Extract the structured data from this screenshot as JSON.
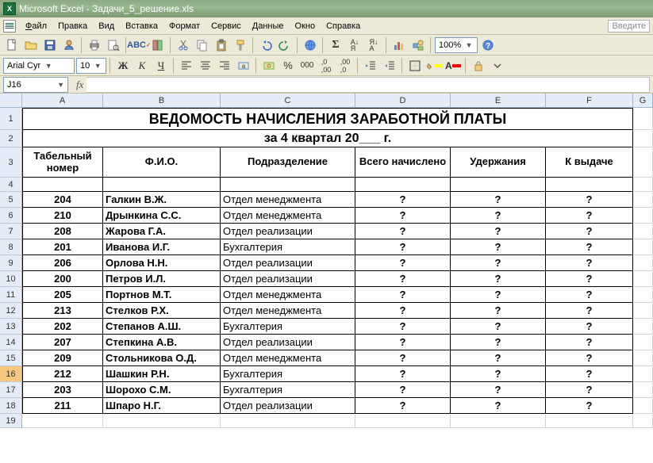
{
  "titlebar": {
    "app": "Microsoft Excel",
    "doc": "Задачи_5_решение.xls"
  },
  "menu": {
    "file": "Файл",
    "edit": "Правка",
    "view": "Вид",
    "insert": "Вставка",
    "format": "Формат",
    "tools": "Сервис",
    "data": "Данные",
    "window": "Окно",
    "help": "Справка",
    "search_hint": "Введите"
  },
  "toolbar": {
    "zoom": "100%"
  },
  "format_bar": {
    "font": "Arial Cyr",
    "size": "10",
    "bold": "Ж",
    "italic": "К",
    "underline": "Ч"
  },
  "namebox": {
    "ref": "J16",
    "fx": "fx"
  },
  "col_labels": [
    "A",
    "B",
    "C",
    "D",
    "E",
    "F",
    "G"
  ],
  "sheet": {
    "title": "ВЕДОМОСТЬ НАЧИСЛЕНИЯ ЗАРАБОТНОЙ ПЛАТЫ",
    "subtitle": "за 4 квартал 20___ г.",
    "headers": {
      "tabno": "Табельный номер",
      "fio": "Ф.И.О.",
      "dept": "Подразделение",
      "total": "Всего начислено",
      "withheld": "Удержания",
      "payout": "К выдаче"
    },
    "qmark": "?",
    "rows": [
      {
        "n": "204",
        "name": "Галкин В.Ж.",
        "dept": "Отдел менеджмента"
      },
      {
        "n": "210",
        "name": "Дрынкина С.С.",
        "dept": "Отдел менеджмента"
      },
      {
        "n": "208",
        "name": "Жарова Г.А.",
        "dept": "Отдел реализации"
      },
      {
        "n": "201",
        "name": "Иванова И.Г.",
        "dept": "Бухгалтерия"
      },
      {
        "n": "206",
        "name": "Орлова Н.Н.",
        "dept": "Отдел реализации"
      },
      {
        "n": "200",
        "name": "Петров И.Л.",
        "dept": "Отдел реализации"
      },
      {
        "n": "205",
        "name": "Портнов М.Т.",
        "dept": "Отдел менеджмента"
      },
      {
        "n": "213",
        "name": "Стелков Р.Х.",
        "dept": "Отдел менеджмента"
      },
      {
        "n": "202",
        "name": "Степанов А.Ш.",
        "dept": "Бухгалтерия"
      },
      {
        "n": "207",
        "name": "Степкина А.В.",
        "dept": "Отдел реализации"
      },
      {
        "n": "209",
        "name": "Стольникова О.Д.",
        "dept": "Отдел менеджмента"
      },
      {
        "n": "212",
        "name": "Шашкин Р.Н.",
        "dept": "Бухгалтерия"
      },
      {
        "n": "203",
        "name": "Шорохо С.М.",
        "dept": "Бухгалтерия"
      },
      {
        "n": "211",
        "name": "Шпаро Н.Г.",
        "dept": "Отдел реализации"
      }
    ]
  }
}
